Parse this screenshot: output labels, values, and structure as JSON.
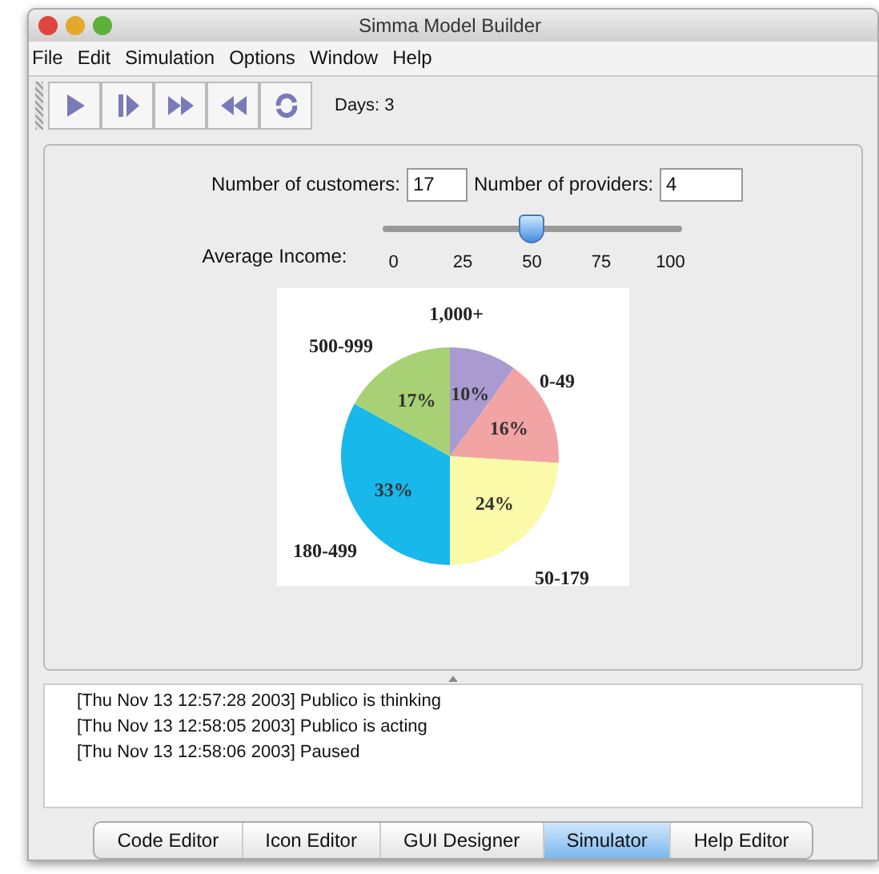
{
  "window": {
    "title": "Simma Model Builder"
  },
  "menu": [
    "File",
    "Edit",
    "Simulation",
    "Options",
    "Window",
    "Help"
  ],
  "toolbar": {
    "days": "Days: 3"
  },
  "fields": [
    {
      "label": "Number of customers:",
      "value": "17"
    },
    {
      "label": "Number of providers:",
      "value": "4"
    }
  ],
  "slider": {
    "label": "Average Income:",
    "level": 0.5,
    "ticks": [
      "0",
      "25",
      "50",
      "75",
      "100"
    ]
  },
  "chart_data": {
    "type": "pie",
    "categories": [
      "1,000+",
      "0-49",
      "50-179",
      "180-499",
      "500-999"
    ],
    "series": [
      {
        "values": [
          10,
          16,
          24,
          33,
          17
        ]
      }
    ],
    "colors": [
      "#a99bd0",
      "#f2a3a3",
      "#fafaa8",
      "#18b8ea",
      "#a8d074"
    ],
    "data_labels": "value_labels",
    "value_labels": [
      "10%",
      "16%",
      "24%",
      "33%",
      "17%"
    ]
  },
  "log": [
    "[Thu Nov 13 12:57:28 2003] Publico is thinking",
    "[Thu Nov 13 12:58:05 2003] Publico is acting",
    "[Thu Nov 13 12:58:06 2003] Paused"
  ],
  "tabs": [
    {
      "label": "Code Editor",
      "selected": false
    },
    {
      "label": "Icon Editor",
      "selected": false
    },
    {
      "label": "GUI Designer",
      "selected": false
    },
    {
      "label": "Simulator",
      "selected": true
    },
    {
      "label": "Help Editor",
      "selected": false
    }
  ]
}
